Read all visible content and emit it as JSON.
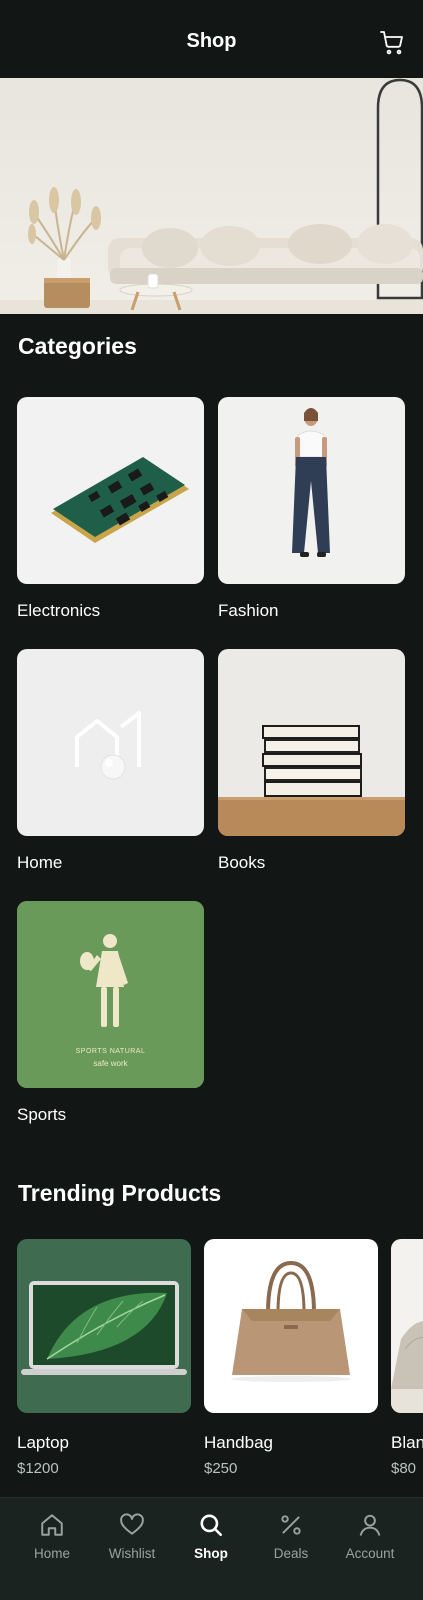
{
  "header": {
    "title": "Shop",
    "cart_icon": "shopping-cart-icon"
  },
  "hero": {
    "image": "living-room-sofa-photo"
  },
  "categories": {
    "title": "Categories",
    "items": [
      {
        "label": "Electronics",
        "image": "circuit-board-photo"
      },
      {
        "label": "Fashion",
        "image": "woman-in-jeans-photo"
      },
      {
        "label": "Home",
        "image": "home-outline-logo"
      },
      {
        "label": "Books",
        "image": "stack-of-books-photo"
      },
      {
        "label": "Sports",
        "image": "sports-figure-poster",
        "caption_line1": "SPORTS NATURAL",
        "caption_line2": "safe work"
      }
    ]
  },
  "trending": {
    "title": "Trending Products",
    "items": [
      {
        "name": "Laptop",
        "price": "$1200",
        "image": "laptop-with-leaf-wallpaper"
      },
      {
        "name": "Handbag",
        "price": "$250",
        "image": "tan-leather-handbag"
      },
      {
        "name": "Blanket",
        "price": "$80",
        "image": "folded-blanket"
      }
    ]
  },
  "bottom_nav": {
    "items": [
      {
        "label": "Home",
        "icon": "home-icon",
        "active": false
      },
      {
        "label": "Wishlist",
        "icon": "heart-icon",
        "active": false
      },
      {
        "label": "Shop",
        "icon": "search-icon",
        "active": true
      },
      {
        "label": "Deals",
        "icon": "percent-icon",
        "active": false
      },
      {
        "label": "Account",
        "icon": "user-icon",
        "active": false
      }
    ]
  },
  "colors": {
    "background": "#121715",
    "nav_background": "#1a2320",
    "text": "#ffffff",
    "muted": "#98a39f",
    "sports_green": "#6a9a5a",
    "laptop_green": "#3f6b50"
  }
}
